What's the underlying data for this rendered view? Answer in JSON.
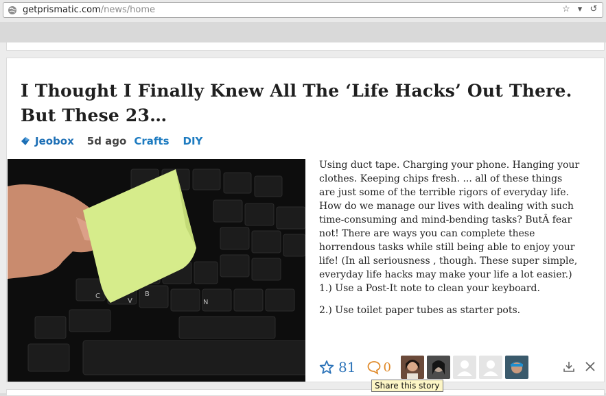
{
  "browser": {
    "url_domain": "getprismatic.com",
    "url_path": "/news/home"
  },
  "article": {
    "title": "I Thought I Finally Knew All The ‘Life Hacks’ Out There. But These 23…",
    "source": "Jeobox",
    "age": "5d ago",
    "tags": [
      "Crafts",
      "DIY"
    ],
    "paragraphs": [
      "Using duct tape. Charging your phone. Hanging your clothes. Keeping chips fresh. ... all of these things are just some of the terrible rigors of everyday life. How do we manage our lives with dealing with such time-consuming and mind-bending tasks? ButÂ fear not! There are ways you can complete these horrendous tasks while still being able to enjoy your life! (In  all   seriousness , though. These super simple, everyday life hacks may make your life a lot easier.) 1.) Use a Post-It note to clean your keyboard.",
      "2.) Use toilet paper tubes as starter pots."
    ],
    "likes": "81",
    "comments": "0",
    "tooltip": "Share this story"
  },
  "colors": {
    "link": "#1d6fb5",
    "like": "#2a72b8",
    "comment": "#e08a2a"
  }
}
